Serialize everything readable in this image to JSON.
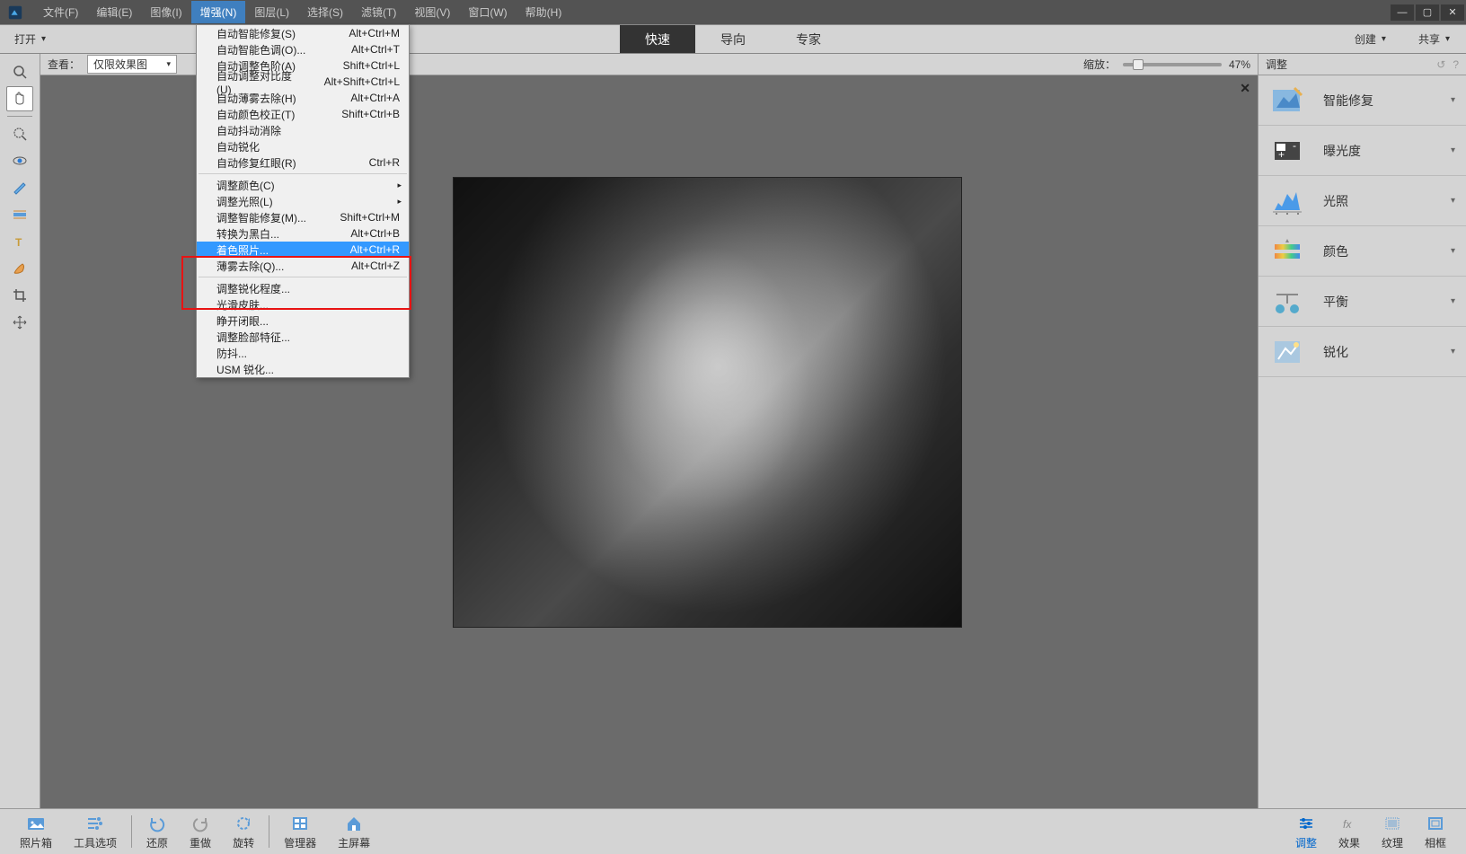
{
  "menubar": {
    "file": "文件(F)",
    "edit": "编辑(E)",
    "image": "图像(I)",
    "enhance": "增强(N)",
    "layer": "图层(L)",
    "select": "选择(S)",
    "filter": "滤镜(T)",
    "view": "视图(V)",
    "window": "窗口(W)",
    "help": "帮助(H)"
  },
  "toolbar": {
    "open": "打开",
    "quick": "快速",
    "guided": "导向",
    "expert": "专家",
    "create": "创建",
    "share": "共享"
  },
  "canvasHeader": {
    "viewLabel": "查看：",
    "viewMode": "仅限效果图",
    "zoomLabel": "缩放：",
    "zoomValue": "47%"
  },
  "rightPanel": {
    "title": "调整",
    "items": [
      {
        "label": "智能修复"
      },
      {
        "label": "曝光度"
      },
      {
        "label": "光照"
      },
      {
        "label": "颜色"
      },
      {
        "label": "平衡"
      },
      {
        "label": "锐化"
      }
    ]
  },
  "dropdown": [
    {
      "t": "item",
      "label": "自动智能修复(S)",
      "short": "Alt+Ctrl+M"
    },
    {
      "t": "item",
      "label": "自动智能色调(O)...",
      "short": "Alt+Ctrl+T"
    },
    {
      "t": "item",
      "label": "自动调整色阶(A)",
      "short": "Shift+Ctrl+L"
    },
    {
      "t": "item",
      "label": "自动调整对比度(U)",
      "short": "Alt+Shift+Ctrl+L"
    },
    {
      "t": "item",
      "label": "自动薄雾去除(H)",
      "short": "Alt+Ctrl+A"
    },
    {
      "t": "item",
      "label": "自动颜色校正(T)",
      "short": "Shift+Ctrl+B"
    },
    {
      "t": "item",
      "label": "自动抖动消除",
      "short": ""
    },
    {
      "t": "item",
      "label": "自动锐化",
      "short": ""
    },
    {
      "t": "item",
      "label": "自动修复红眼(R)",
      "short": "Ctrl+R"
    },
    {
      "t": "sep"
    },
    {
      "t": "sub",
      "label": "调整颜色(C)",
      "short": ""
    },
    {
      "t": "sub",
      "label": "调整光照(L)",
      "short": ""
    },
    {
      "t": "item",
      "label": "调整智能修复(M)...",
      "short": "Shift+Ctrl+M"
    },
    {
      "t": "item",
      "label": "转换为黑白...",
      "short": "Alt+Ctrl+B"
    },
    {
      "t": "item",
      "label": "着色照片...",
      "short": "Alt+Ctrl+R",
      "hl": true
    },
    {
      "t": "item",
      "label": "薄雾去除(Q)...",
      "short": "Alt+Ctrl+Z"
    },
    {
      "t": "sep"
    },
    {
      "t": "item",
      "label": "调整锐化程度...",
      "short": ""
    },
    {
      "t": "item",
      "label": "光滑皮肤...",
      "short": ""
    },
    {
      "t": "item",
      "label": "睁开闭眼...",
      "short": ""
    },
    {
      "t": "item",
      "label": "调整脸部特征...",
      "short": ""
    },
    {
      "t": "item",
      "label": "防抖...",
      "short": ""
    },
    {
      "t": "item",
      "label": "USM 锐化...",
      "short": ""
    }
  ],
  "bottomBar": {
    "photoBin": "照片箱",
    "toolOptions": "工具选项",
    "undo": "还原",
    "redo": "重做",
    "rotate": "旋转",
    "organizer": "管理器",
    "home": "主屏幕",
    "adjust": "调整",
    "effects": "效果",
    "texture": "纹理",
    "frame": "相框"
  }
}
